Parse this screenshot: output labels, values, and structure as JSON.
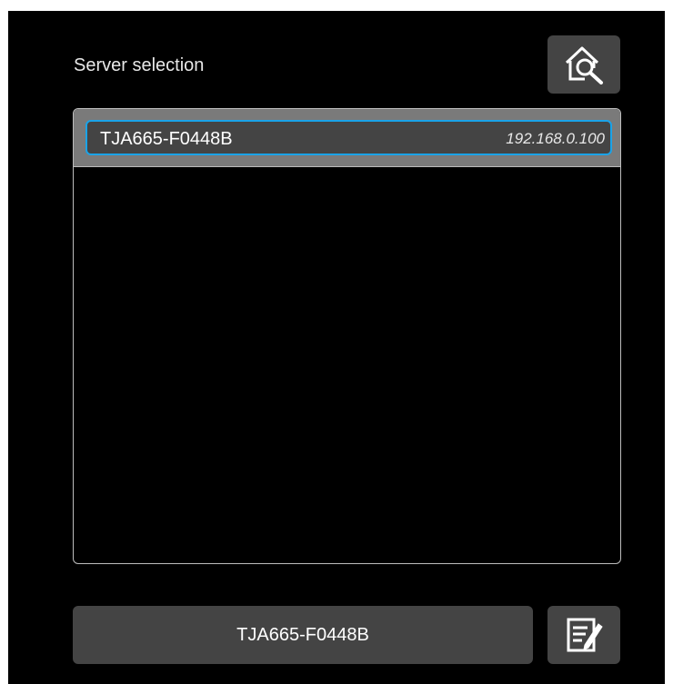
{
  "header": {
    "title": "Server selection",
    "search_icon": "house-search-icon"
  },
  "server_list": {
    "items": [
      {
        "name": "TJA665-F0448B",
        "ip": "192.168.0.100",
        "selected": true
      }
    ]
  },
  "footer": {
    "selected_server": "TJA665-F0448B",
    "edit_icon": "edit-note-icon"
  },
  "colors": {
    "background": "#000000",
    "accent": "#1aa3e8",
    "button": "#444444"
  }
}
